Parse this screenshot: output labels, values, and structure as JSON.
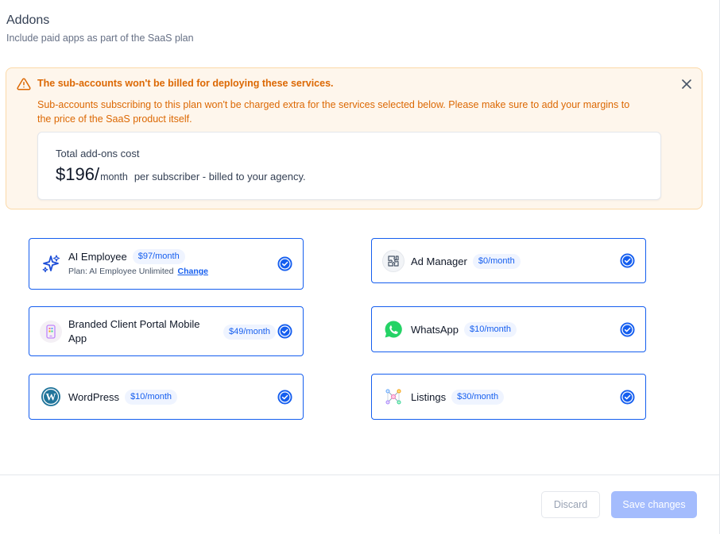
{
  "header": {
    "title": "Addons",
    "subtitle": "Include paid apps as part of the SaaS plan"
  },
  "alert": {
    "title": "The sub-accounts won't be billed for deploying these services.",
    "body": "Sub-accounts subscribing to this plan won't be charged extra for the services selected below. Please make sure to add your margins to the price of the SaaS product itself.",
    "cost_label": "Total add-ons cost",
    "cost_amount": "$196/",
    "cost_unit": "month",
    "cost_desc": "per subscriber - billed to your agency.",
    "accent_color": "#dc6803"
  },
  "addons": [
    {
      "name": "AI Employee",
      "price": "$97/month",
      "plan_label": "Plan: AI Employee Unlimited",
      "change_label": "Change",
      "icon": "sparkle-icon",
      "selected": true
    },
    {
      "name": "Ad Manager",
      "price": "$0/month",
      "icon": "puzzle-icon",
      "selected": true
    },
    {
      "name": "Branded Client Portal Mobile App",
      "price": "$49/month",
      "icon": "mobile-app-icon",
      "selected": true
    },
    {
      "name": "WhatsApp",
      "price": "$10/month",
      "icon": "whatsapp-icon",
      "selected": true
    },
    {
      "name": "WordPress",
      "price": "$10/month",
      "icon": "wordpress-icon",
      "selected": true
    },
    {
      "name": "Listings",
      "price": "$30/month",
      "icon": "listings-network-icon",
      "selected": true
    }
  ],
  "footer": {
    "discard_label": "Discard",
    "save_label": "Save changes"
  },
  "colors": {
    "primary": "#155eef",
    "primary_disabled": "#a4bcfd"
  }
}
